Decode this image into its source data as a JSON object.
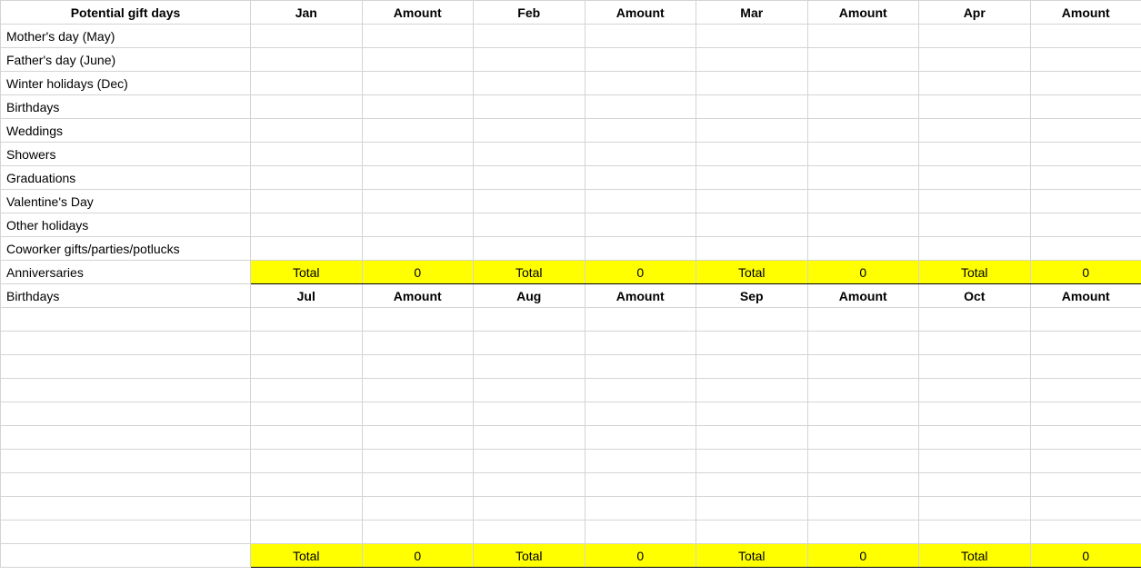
{
  "header1": {
    "first": "Potential gift days",
    "pairs": [
      {
        "month": "Jan",
        "amount": "Amount"
      },
      {
        "month": "Feb",
        "amount": "Amount"
      },
      {
        "month": "Mar",
        "amount": "Amount"
      },
      {
        "month": "Apr",
        "amount": "Amount"
      }
    ]
  },
  "giftDays": [
    "Mother's day (May)",
    "Father's day (June)",
    "Winter holidays (Dec)",
    "Birthdays",
    "Weddings",
    "Showers",
    "Graduations",
    "Valentine's Day",
    "Other holidays",
    "Coworker gifts/parties/potlucks"
  ],
  "totalRow1": {
    "first": "Anniversaries",
    "cells": [
      "Total",
      "0",
      "Total",
      "0",
      "Total",
      "0",
      "Total",
      "0"
    ]
  },
  "header2": {
    "first": "Birthdays",
    "pairs": [
      {
        "month": "Jul",
        "amount": "Amount"
      },
      {
        "month": "Aug",
        "amount": "Amount"
      },
      {
        "month": "Sep",
        "amount": "Amount"
      },
      {
        "month": "Oct",
        "amount": "Amount"
      }
    ]
  },
  "blankRows2": 10,
  "totalRow2": {
    "first": "",
    "cells": [
      "Total",
      "0",
      "Total",
      "0",
      "Total",
      "0",
      "Total",
      "0"
    ]
  }
}
